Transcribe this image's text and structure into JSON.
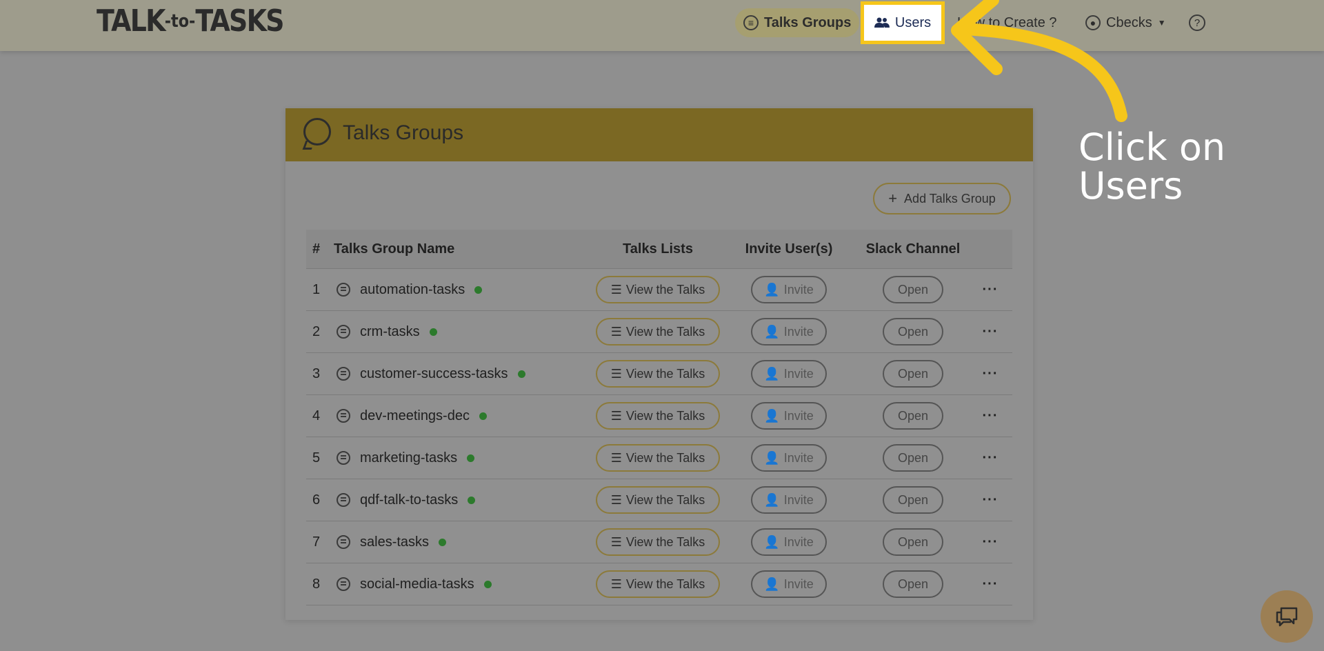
{
  "brand": {
    "main": "TALK",
    "joiner": "-to-",
    "end": "TASKS"
  },
  "nav": {
    "talks_groups": "Talks Groups",
    "users": "Users",
    "how_to": "How to Create ?",
    "user_name": "Cbecks",
    "help": "?"
  },
  "card": {
    "title": "Talks Groups",
    "add_button": "Add Talks Group"
  },
  "table": {
    "headers": {
      "num": "#",
      "name": "Talks Group Name",
      "talks": "Talks Lists",
      "invite": "Invite User(s)",
      "slack": "Slack Channel"
    },
    "view_label": "View the Talks",
    "invite_label": "Invite",
    "open_label": "Open",
    "more_label": "···",
    "rows": [
      {
        "num": "1",
        "name": "automation-tasks"
      },
      {
        "num": "2",
        "name": "crm-tasks"
      },
      {
        "num": "3",
        "name": "customer-success-tasks"
      },
      {
        "num": "4",
        "name": "dev-meetings-dec"
      },
      {
        "num": "5",
        "name": "marketing-tasks"
      },
      {
        "num": "6",
        "name": "qdf-talk-to-tasks"
      },
      {
        "num": "7",
        "name": "sales-tasks"
      },
      {
        "num": "8",
        "name": "social-media-tasks"
      }
    ]
  },
  "annotation": {
    "line1": "Click on",
    "line2": "Users"
  },
  "colors": {
    "accent": "#f6c61a",
    "status_dot": "#2c7a2c"
  }
}
